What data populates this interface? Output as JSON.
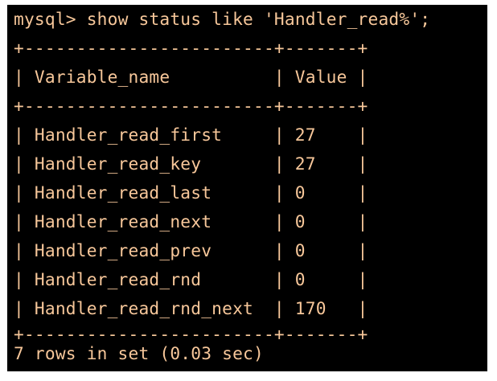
{
  "terminal": {
    "background": "#000000",
    "text_color": "#f7c79a",
    "prompt": "mysql> ",
    "command": "show status like 'Handler_read%';",
    "border_line": "+------------------------+-------+",
    "header_line": "| Variable_name          | Value |",
    "columns": [
      "Variable_name",
      "Value"
    ],
    "rows": [
      {
        "name": "Handler_read_first",
        "value": "27",
        "text": "| Handler_read_first     | 27    |"
      },
      {
        "name": "Handler_read_key",
        "value": "27",
        "text": "| Handler_read_key       | 27    |"
      },
      {
        "name": "Handler_read_last",
        "value": "0",
        "text": "| Handler_read_last      | 0     |"
      },
      {
        "name": "Handler_read_next",
        "value": "0",
        "text": "| Handler_read_next      | 0     |"
      },
      {
        "name": "Handler_read_prev",
        "value": "0",
        "text": "| Handler_read_prev      | 0     |"
      },
      {
        "name": "Handler_read_rnd",
        "value": "0",
        "text": "| Handler_read_rnd       | 0     |"
      },
      {
        "name": "Handler_read_rnd_next",
        "value": "170",
        "text": "| Handler_read_rnd_next  | 170   |"
      }
    ],
    "summary": "7 rows in set (0.03 sec)"
  }
}
